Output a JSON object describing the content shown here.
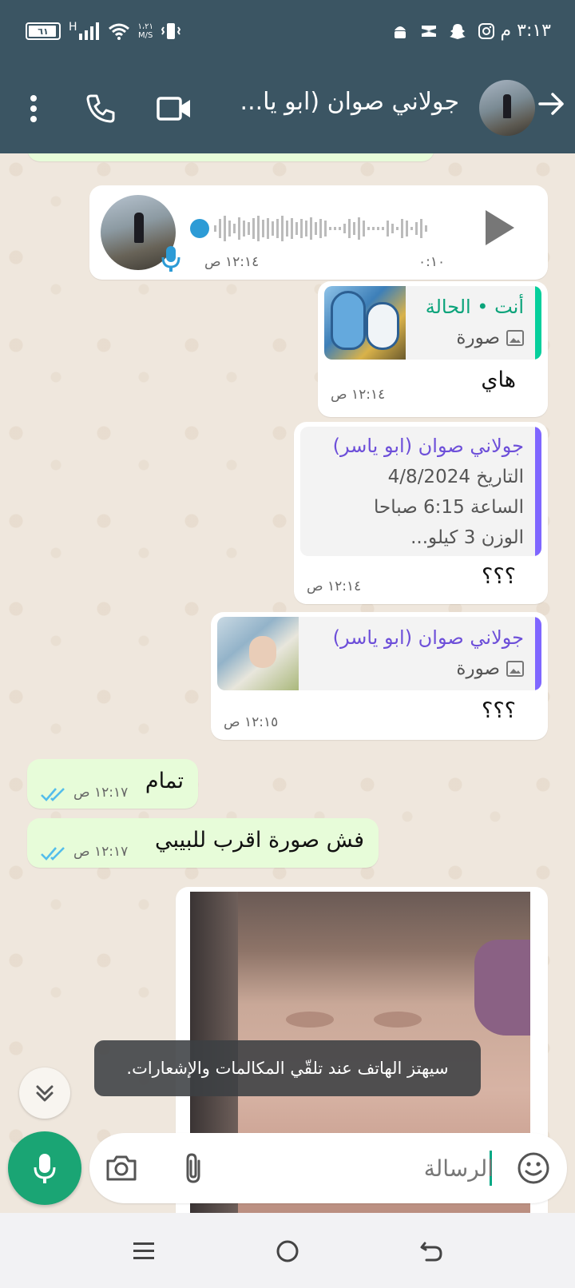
{
  "status_bar": {
    "time": "٣:١٣ م",
    "battery": "٦١",
    "net_speed_value": "١،٢١",
    "net_speed_unit": "M/S",
    "signal_type": "H"
  },
  "header": {
    "contact_name": "جولاني صوان (ابو يا...",
    "icons": [
      "back-arrow-icon",
      "video-call-icon",
      "voice-call-icon",
      "more-options-icon"
    ]
  },
  "messages": [
    {
      "type": "voice",
      "direction": "incoming",
      "duration": "٠:١٠",
      "time": "١٢:١٤ ص"
    },
    {
      "type": "reply",
      "direction": "incoming",
      "quote_name": "أنت • الحالة",
      "quote_media": "صورة",
      "text": "هاي",
      "time": "١٢:١٤ ص",
      "quote_color": "#06cf9c"
    },
    {
      "type": "reply",
      "direction": "incoming",
      "quote_name": "جولاني صوان (ابو ياسر)",
      "quote_lines": [
        "التاريخ 4/8/2024",
        "الساعة 6:15 صباحا",
        "الوزن 3 كيلو..."
      ],
      "text": "؟؟؟",
      "time": "١٢:١٤ ص",
      "quote_color": "#7f66ff"
    },
    {
      "type": "reply",
      "direction": "incoming",
      "quote_name": "جولاني صوان (ابو ياسر)",
      "quote_media": "صورة",
      "text": "؟؟؟",
      "time": "١٢:١٥ ص",
      "quote_color": "#7f66ff"
    },
    {
      "type": "text",
      "direction": "outgoing",
      "text": "تمام",
      "time": "١٢:١٧ ص",
      "status": "read"
    },
    {
      "type": "text",
      "direction": "outgoing",
      "text": "فش صورة اقرب للبيبي",
      "time": "١٢:١٧ ص",
      "status": "read"
    },
    {
      "type": "image",
      "direction": "incoming"
    }
  ],
  "toast": "سيهتز الهاتف عند تلقّي المكالمات والإشعارات.",
  "composer": {
    "placeholder": "الرسالة",
    "icons": [
      "emoji-icon",
      "attach-icon",
      "camera-icon",
      "mic-icon"
    ]
  },
  "colors": {
    "header_bg": "#3b5563",
    "chat_bg": "#efe7dd",
    "outgoing_bubble": "#e7fcd9",
    "accent_green": "#1aa574",
    "read_ticks": "#53bdeb"
  }
}
